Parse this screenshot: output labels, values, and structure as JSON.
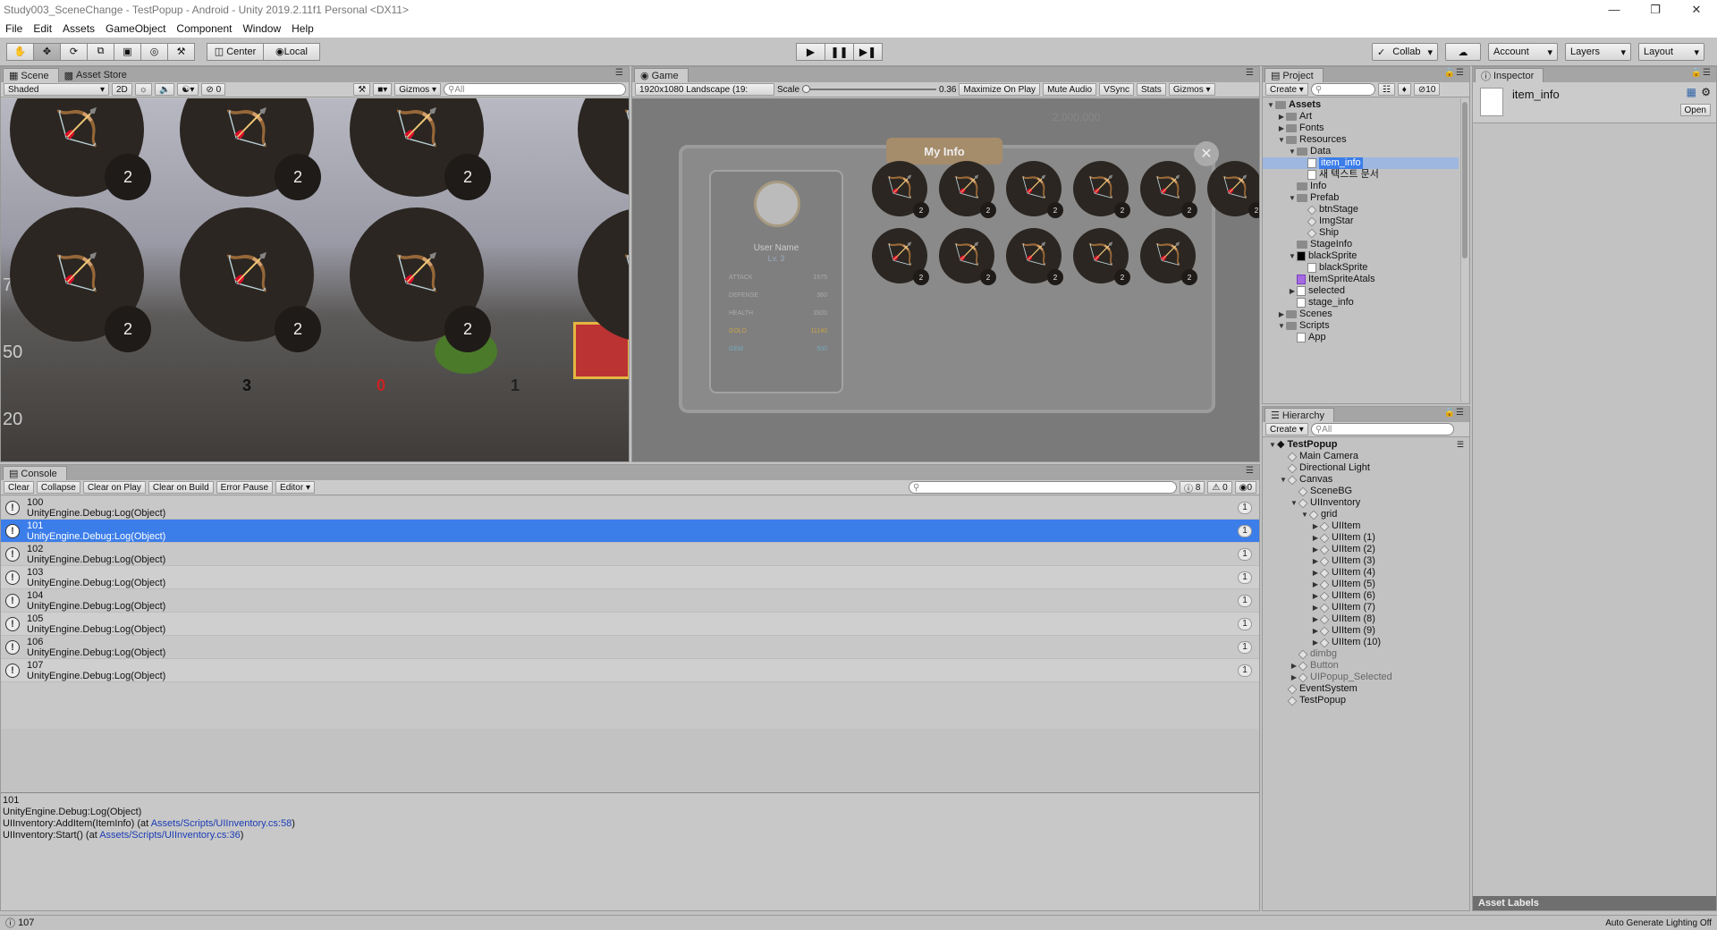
{
  "window": {
    "title": "Study003_SceneChange - TestPopup - Android - Unity 2019.2.11f1 Personal <DX11>"
  },
  "menu": [
    "File",
    "Edit",
    "Assets",
    "GameObject",
    "Component",
    "Window",
    "Help"
  ],
  "toolbar": {
    "pivot": "Center",
    "space": "Local",
    "collab": "Collab",
    "account": "Account",
    "layers": "Layers",
    "layout": "Layout"
  },
  "scene": {
    "tab": "Scene",
    "tab2": "Asset Store",
    "shading": "Shaded",
    "mode2d": "2D",
    "fx_count": "0",
    "gizmos": "Gizmos",
    "search_placeholder": "All",
    "counts": [
      "2",
      "2",
      "2",
      "2",
      "2",
      "2"
    ],
    "bg_numbers": [
      "3",
      "0",
      "1",
      "75",
      "50",
      "20",
      "20",
      "1"
    ]
  },
  "game": {
    "tab": "Game",
    "resolution": "1920x1080 Landscape (19:",
    "scale_label": "Scale",
    "scale_value": "0.36",
    "maximize": "Maximize On Play",
    "mute": "Mute Audio",
    "vsync": "VSync",
    "stats": "Stats",
    "gizmos": "Gizmos",
    "popup_title": "My Info",
    "user_name": "User Name",
    "level": "Lv. 3",
    "stats_rows": [
      {
        "label": "ATTACK",
        "value": "1575"
      },
      {
        "label": "DEFENSE",
        "value": "360"
      },
      {
        "label": "HEALTH",
        "value": "3920"
      },
      {
        "label": "GOLD",
        "value": "11140"
      },
      {
        "label": "GEM",
        "value": "500"
      }
    ],
    "top_gold": "2,000,000",
    "slot_count": "2"
  },
  "console": {
    "tab": "Console",
    "buttons": [
      "Clear",
      "Collapse",
      "Clear on Play",
      "Clear on Build",
      "Error Pause",
      "Editor"
    ],
    "log_count": "8",
    "warn_count": "0",
    "err_count": "0",
    "logs": [
      {
        "id": "100",
        "msg": "UnityEngine.Debug:Log(Object)",
        "n": "1"
      },
      {
        "id": "101",
        "msg": "UnityEngine.Debug:Log(Object)",
        "n": "1"
      },
      {
        "id": "102",
        "msg": "UnityEngine.Debug:Log(Object)",
        "n": "1"
      },
      {
        "id": "103",
        "msg": "UnityEngine.Debug:Log(Object)",
        "n": "1"
      },
      {
        "id": "104",
        "msg": "UnityEngine.Debug:Log(Object)",
        "n": "1"
      },
      {
        "id": "105",
        "msg": "UnityEngine.Debug:Log(Object)",
        "n": "1"
      },
      {
        "id": "106",
        "msg": "UnityEngine.Debug:Log(Object)",
        "n": "1"
      },
      {
        "id": "107",
        "msg": "UnityEngine.Debug:Log(Object)",
        "n": "1"
      }
    ],
    "detail": {
      "l1": "101",
      "l2": "UnityEngine.Debug:Log(Object)",
      "l3a": "UIInventory:AddItem(ItemInfo) (at ",
      "l3link": "Assets/Scripts/UIInventory.cs:58",
      "l3b": ")",
      "l4a": "UIInventory:Start() (at ",
      "l4link": "Assets/Scripts/UIInventory.cs:36",
      "l4b": ")"
    }
  },
  "project": {
    "tab": "Project",
    "create": "Create",
    "filter_count": "10",
    "items": [
      {
        "label": "Assets",
        "depth": 0,
        "arrow": "▼",
        "type": "folder",
        "bold": true
      },
      {
        "label": "Art",
        "depth": 1,
        "arrow": "▶",
        "type": "folder"
      },
      {
        "label": "Fonts",
        "depth": 1,
        "arrow": "▶",
        "type": "folder"
      },
      {
        "label": "Resources",
        "depth": 1,
        "arrow": "▼",
        "type": "folder"
      },
      {
        "label": "Data",
        "depth": 2,
        "arrow": "▼",
        "type": "folder"
      },
      {
        "label": "item_info",
        "depth": 3,
        "arrow": "",
        "type": "file",
        "sel": true
      },
      {
        "label": "새 텍스트 문서",
        "depth": 3,
        "arrow": "",
        "type": "file"
      },
      {
        "label": "Info",
        "depth": 2,
        "arrow": "",
        "type": "folder"
      },
      {
        "label": "Prefab",
        "depth": 2,
        "arrow": "▼",
        "type": "folder"
      },
      {
        "label": "btnStage",
        "depth": 3,
        "arrow": "",
        "type": "cube"
      },
      {
        "label": "ImgStar",
        "depth": 3,
        "arrow": "",
        "type": "cube"
      },
      {
        "label": "Ship",
        "depth": 3,
        "arrow": "",
        "type": "cube"
      },
      {
        "label": "StageInfo",
        "depth": 2,
        "arrow": "",
        "type": "folder"
      },
      {
        "label": "blackSprite",
        "depth": 2,
        "arrow": "▼",
        "type": "black"
      },
      {
        "label": "blackSprite",
        "depth": 3,
        "arrow": "",
        "type": "file"
      },
      {
        "label": "ItemSpriteAtals",
        "depth": 2,
        "arrow": "",
        "type": "atlas"
      },
      {
        "label": "selected",
        "depth": 2,
        "arrow": "▶",
        "type": "file"
      },
      {
        "label": "stage_info",
        "depth": 2,
        "arrow": "",
        "type": "file"
      },
      {
        "label": "Scenes",
        "depth": 1,
        "arrow": "▶",
        "type": "folder"
      },
      {
        "label": "Scripts",
        "depth": 1,
        "arrow": "▼",
        "type": "folder"
      },
      {
        "label": "App",
        "depth": 2,
        "arrow": "",
        "type": "file"
      }
    ]
  },
  "hierarchy": {
    "tab": "Hierarchy",
    "create": "Create",
    "search_placeholder": "All",
    "items": [
      {
        "label": "TestPopup",
        "depth": 0,
        "arrow": "▼",
        "bold": true
      },
      {
        "label": "Main Camera",
        "depth": 1,
        "arrow": ""
      },
      {
        "label": "Directional Light",
        "depth": 1,
        "arrow": ""
      },
      {
        "label": "Canvas",
        "depth": 1,
        "arrow": "▼"
      },
      {
        "label": "SceneBG",
        "depth": 2,
        "arrow": ""
      },
      {
        "label": "UIInventory",
        "depth": 2,
        "arrow": "▼"
      },
      {
        "label": "grid",
        "depth": 3,
        "arrow": "▼"
      },
      {
        "label": "UIItem",
        "depth": 4,
        "arrow": "▶"
      },
      {
        "label": "UIItem (1)",
        "depth": 4,
        "arrow": "▶"
      },
      {
        "label": "UIItem (2)",
        "depth": 4,
        "arrow": "▶"
      },
      {
        "label": "UIItem (3)",
        "depth": 4,
        "arrow": "▶"
      },
      {
        "label": "UIItem (4)",
        "depth": 4,
        "arrow": "▶"
      },
      {
        "label": "UIItem (5)",
        "depth": 4,
        "arrow": "▶"
      },
      {
        "label": "UIItem (6)",
        "depth": 4,
        "arrow": "▶"
      },
      {
        "label": "UIItem (7)",
        "depth": 4,
        "arrow": "▶"
      },
      {
        "label": "UIItem (8)",
        "depth": 4,
        "arrow": "▶"
      },
      {
        "label": "UIItem (9)",
        "depth": 4,
        "arrow": "▶"
      },
      {
        "label": "UIItem (10)",
        "depth": 4,
        "arrow": "▶"
      },
      {
        "label": "dimbg",
        "depth": 2,
        "arrow": "",
        "dim": true
      },
      {
        "label": "Button",
        "depth": 2,
        "arrow": "▶",
        "dim": true
      },
      {
        "label": "UIPopup_Selected",
        "depth": 2,
        "arrow": "▶",
        "dim": true
      },
      {
        "label": "EventSystem",
        "depth": 1,
        "arrow": ""
      },
      {
        "label": "TestPopup",
        "depth": 1,
        "arrow": ""
      }
    ]
  },
  "inspector": {
    "tab": "Inspector",
    "asset_name": "item_info",
    "open_button": "Open",
    "asset_labels": "Asset Labels"
  },
  "status": {
    "message": "107",
    "lighting": "Auto Generate Lighting Off"
  },
  "colors": {
    "selection": "#3b7de9",
    "link": "#1a3cb5"
  }
}
